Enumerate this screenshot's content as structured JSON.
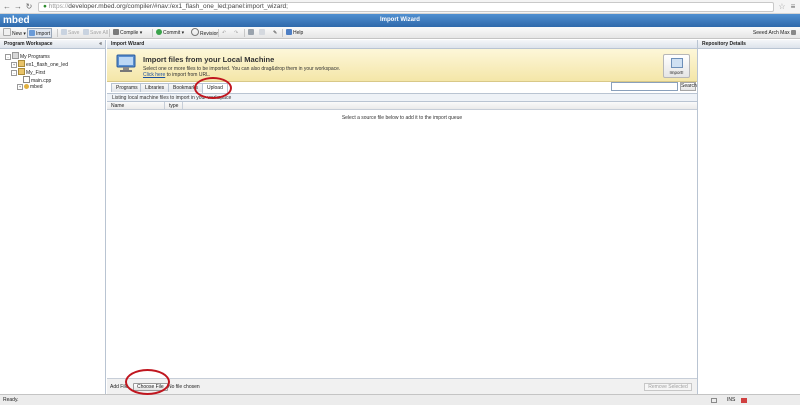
{
  "browser": {
    "url_scheme": "https://",
    "url_rest": "developer.mbed.org/compiler/#nav:/ex1_flash_one_led;panel:import_wizard;"
  },
  "app": {
    "brand": "mbed",
    "window_title": "Import Wizard",
    "user": "Seeed Arch Max"
  },
  "toolbar": {
    "new": "New",
    "import": "Import",
    "save": "Save",
    "save_all": "Save All",
    "compile": "Compile",
    "commit": "Commit",
    "revision": "Revision",
    "help": "Help"
  },
  "left": {
    "title": "Program Workspace",
    "tree": {
      "root": "My Programs",
      "item1": "ex1_flash_one_led",
      "item2": "My_First",
      "item2_child1": "main.cpp",
      "item2_child2": "mbed"
    }
  },
  "center": {
    "title": "Import Wizard",
    "banner_title": "Import files from your Local Machine",
    "banner_desc": "Select one or more files to be imported. You can also drag&drop them in your workspace.",
    "banner_link": "Click here",
    "banner_link_rest": " to import from URL.",
    "import_button": "Import!",
    "tabs": [
      "Programs",
      "Libraries",
      "Bookmarks",
      "Upload"
    ],
    "listing": "Listing local machine files to import in your workspace",
    "columns": [
      "Name",
      "type"
    ],
    "empty_message": "Select a source file below to add it to the import queue",
    "add_label": "Add File",
    "choose_file": "Choose File",
    "no_file": "No file chosen",
    "remove_selected": "Remove Selected",
    "search_button": "Search"
  },
  "right": {
    "title": "Repository Details"
  },
  "status": {
    "text": "Ready.",
    "ins": "INS"
  },
  "colors": {
    "title_bar": "#2f69ab",
    "banner": "#f4e6a8",
    "annotation_ring": "#c0161f"
  }
}
